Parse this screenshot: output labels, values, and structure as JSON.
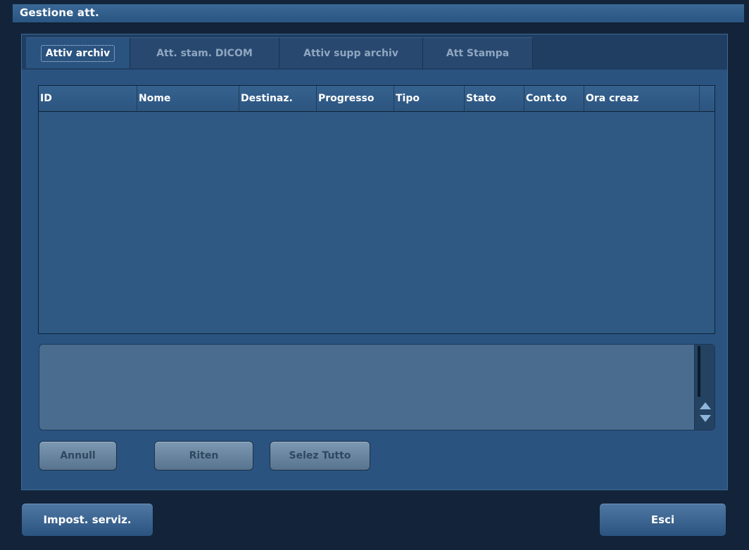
{
  "window": {
    "title": "Gestione att."
  },
  "tabs": [
    {
      "label": "Attiv archiv",
      "active": true
    },
    {
      "label": "Att. stam. DICOM",
      "active": false
    },
    {
      "label": "Attiv supp archiv",
      "active": false
    },
    {
      "label": "Att Stampa",
      "active": false
    }
  ],
  "table": {
    "columns": [
      "ID",
      "Nome",
      "Destinaz.",
      "Progresso",
      "Tipo",
      "Stato",
      "Cont.to",
      "Ora creaz"
    ],
    "rows": []
  },
  "message_box": {
    "text": ""
  },
  "actions": {
    "cancel_label": "Annull",
    "retry_label": "Riten",
    "select_all_label": "Selez Tutto"
  },
  "footer": {
    "service_settings_label": "Impost. serviz.",
    "exit_label": "Esci"
  },
  "icons": {
    "scroll_up": "chevron-up-icon",
    "scroll_down": "chevron-down-icon"
  },
  "colors": {
    "panel": "#2a5380",
    "titlebar": "#2f5b88",
    "accent": "#8fb6da"
  }
}
